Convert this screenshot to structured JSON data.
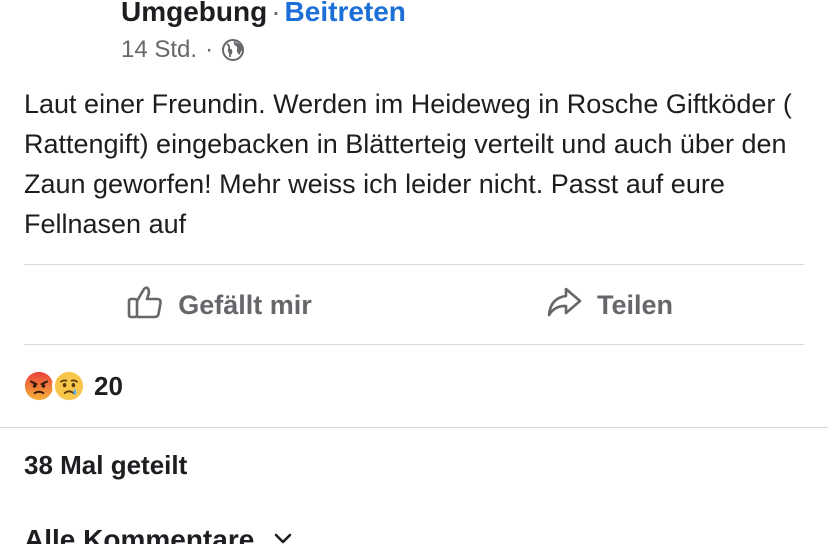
{
  "header": {
    "group_name": "Umgebung",
    "separator": "·",
    "join_label": "Beitreten",
    "time": "14 Std.",
    "meta_dot": "·",
    "privacy_icon": "globe-icon"
  },
  "post": {
    "text": "Laut einer Freundin. Werden im Heideweg in Rosche Giftköder ( Rattengift) eingebacken in Blätterteig verteilt und auch über den Zaun geworfen! Mehr weiss ich leider nicht. Passt auf eure Fellnasen auf"
  },
  "actions": {
    "like_label": "Gefällt mir",
    "like_icon": "thumbs-up-icon",
    "share_label": "Teilen",
    "share_icon": "share-arrow-icon"
  },
  "reactions": {
    "icons": [
      "angry-emoji-icon",
      "sad-emoji-icon"
    ],
    "count": "20"
  },
  "shares": {
    "label": "38 Mal geteilt"
  },
  "comments": {
    "label": "Alle Kommentare",
    "icon": "chevron-down-icon"
  },
  "colors": {
    "link": "#1b6fd6",
    "muted": "#65676b",
    "text": "#1c1e21",
    "divider": "#d7d9dd"
  }
}
